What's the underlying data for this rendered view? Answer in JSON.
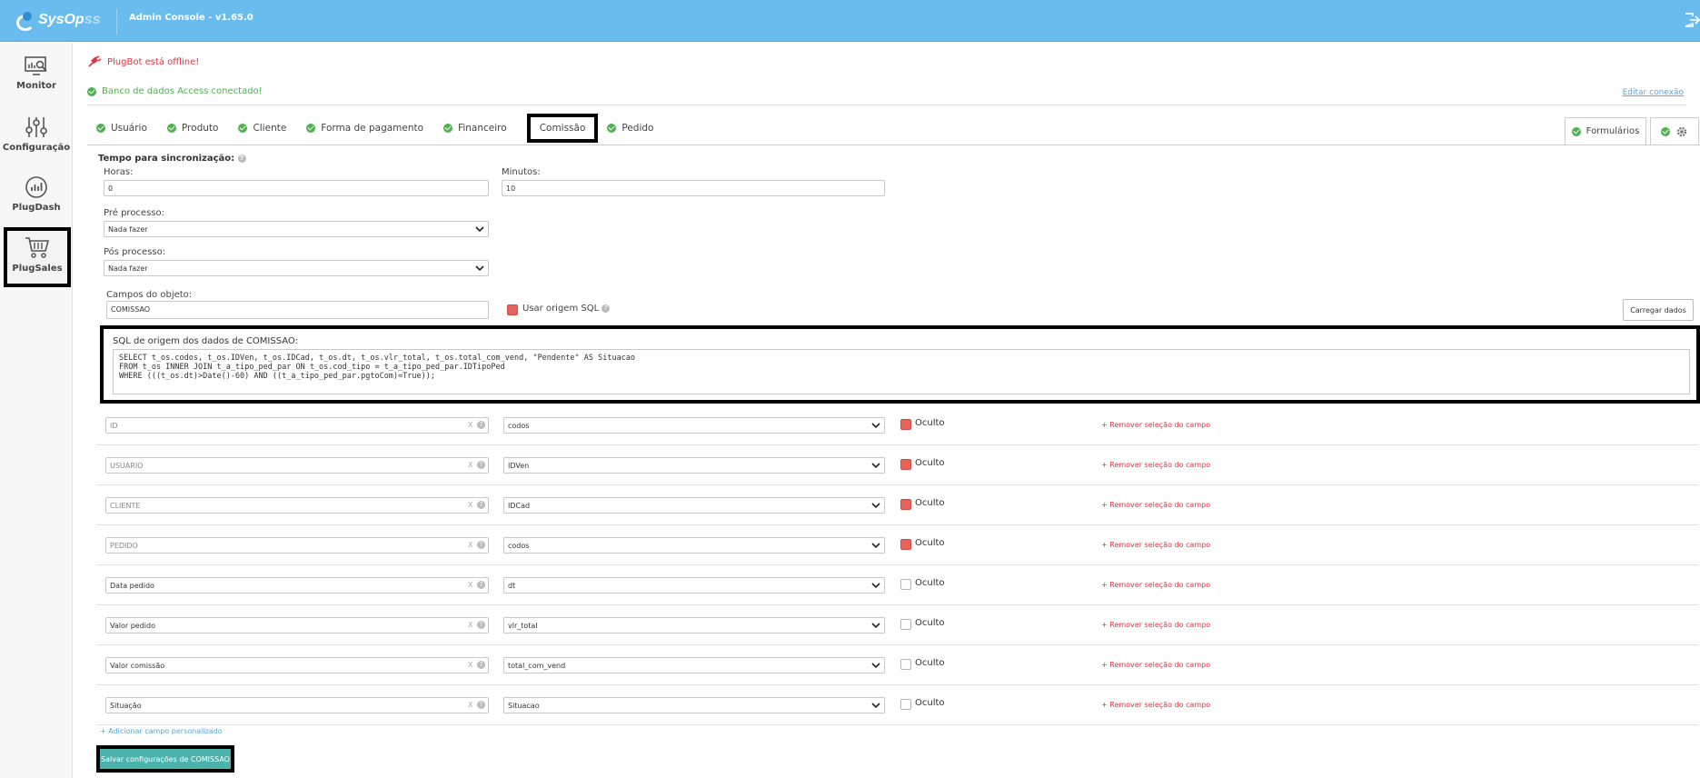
{
  "header": {
    "logo_text_a": "SysOp",
    "logo_text_b": "ss",
    "title": "Admin Console - v1.65.0"
  },
  "sidebar": {
    "items": [
      {
        "label": "Monitor",
        "icon": "monitor-icon"
      },
      {
        "label": "Configuração",
        "icon": "sliders-icon"
      },
      {
        "label": "PlugDash",
        "icon": "dashboard-icon"
      },
      {
        "label": "PlugSales",
        "icon": "cart-icon"
      }
    ]
  },
  "alerts": {
    "offline": "PlugBot está offline!",
    "db": "Banco de dados Access conectado!",
    "edit_link": "Editar conexão"
  },
  "tabs": [
    "Usuário",
    "Produto",
    "Cliente",
    "Forma de pagamento",
    "Financeiro",
    "Comissão",
    "Pedido"
  ],
  "active_tab": "Comissão",
  "right_tab": "Formulários",
  "form": {
    "sync_label": "Tempo para sincronização:",
    "hours_label": "Horas:",
    "hours_value": "0",
    "minutes_label": "Minutos:",
    "minutes_value": "10",
    "pre_label": "Pré processo:",
    "pre_value": "Nada fazer",
    "post_label": "Pós processo:",
    "post_value": "Nada fazer",
    "fields_label": "Campos do objeto:",
    "fields_value": "COMISSAO",
    "use_sql_label": "Usar origem SQL",
    "load_button": "Carregar dados",
    "sql_label": "SQL de origem dos dados de COMISSAO:"
  },
  "sql_lines": [
    "SELECT t_os.codos, t_os.IDVen, t_os.IDCad, t_os.dt, t_os.vlr_total, t_os.total_com_vend, \"Pendente\" AS Situacao",
    "FROM t_os INNER JOIN t_a_tipo_ped_par ON t_os.cod_tipo = t_a_tipo_ped_par.IDTipoPed",
    "WHERE (((t_os.dt)>Date()-60) AND ((t_a_tipo_ped_par.pgtoCom)=True));"
  ],
  "field_rows": [
    {
      "name": "ID",
      "value": "codos",
      "hidden": true
    },
    {
      "name": "USUARIO",
      "value": "IDVen",
      "hidden": true
    },
    {
      "name": "CLIENTE",
      "value": "IDCad",
      "hidden": true
    },
    {
      "name": "PEDIDO",
      "value": "codos",
      "hidden": true
    },
    {
      "name": "Data pedido",
      "value": "dt",
      "hidden": false
    },
    {
      "name": "Valor pedido",
      "value": "vlr_total",
      "hidden": false
    },
    {
      "name": "Valor comissão",
      "value": "total_com_vend",
      "hidden": false
    },
    {
      "name": "Situação",
      "value": "Situacao",
      "hidden": false
    }
  ],
  "row_labels": {
    "clear": "X",
    "hidden": "Oculto",
    "remove": "+ Remover seleção do campo"
  },
  "add_field": "+ Adicionar campo personalizado",
  "save_button": "Salvar configurações de COMISSAO"
}
